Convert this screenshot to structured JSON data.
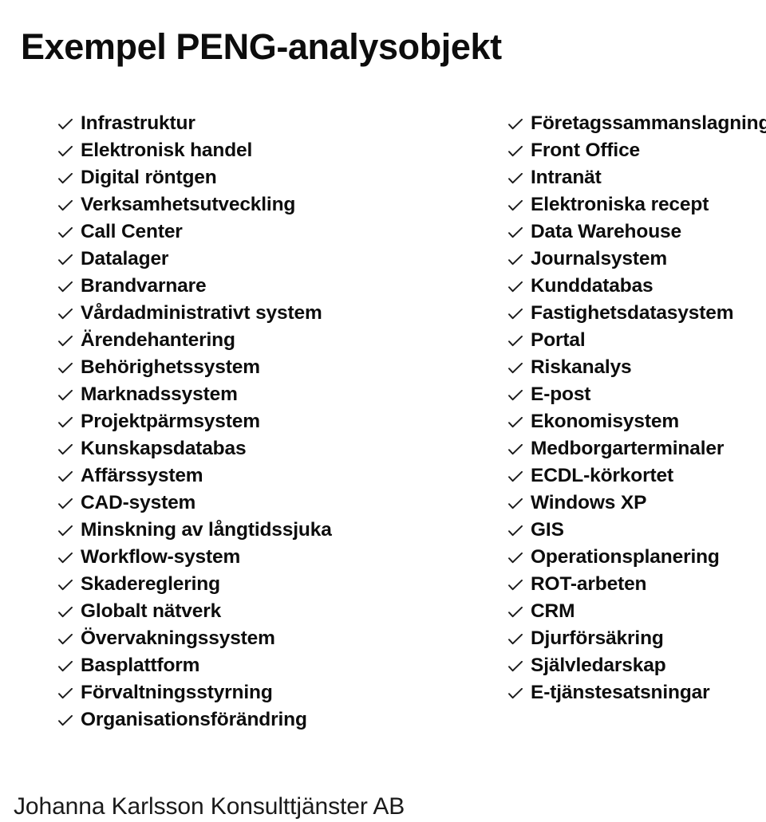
{
  "slide": {
    "title": "Exempel PENG-analysobjekt",
    "footer": "Johanna Karlsson Konsulttjänster AB",
    "bullet_icon": "check-icon",
    "text_color": "#0d0d0d",
    "background_color": "#ffffff"
  },
  "left_column": {
    "items": [
      {
        "label": "Infrastruktur"
      },
      {
        "label": "Elektronisk handel"
      },
      {
        "label": "Digital röntgen"
      },
      {
        "label": "Verksamhetsutveckling"
      },
      {
        "label": "Call Center"
      },
      {
        "label": "Datalager"
      },
      {
        "label": "Brandvarnare"
      },
      {
        "label": "Vårdadministrativt system"
      },
      {
        "label": "Ärendehantering"
      },
      {
        "label": "Behörighetssystem"
      },
      {
        "label": "Marknadssystem"
      },
      {
        "label": "Projektpärmsystem"
      },
      {
        "label": "Kunskapsdatabas"
      },
      {
        "label": "Affärssystem"
      },
      {
        "label": "CAD-system"
      },
      {
        "label": "Minskning av långtidssjuka"
      },
      {
        "label": "Workflow-system"
      },
      {
        "label": "Skadereglering"
      },
      {
        "label": "Globalt nätverk"
      },
      {
        "label": "Övervakningssystem"
      },
      {
        "label": "Basplattform"
      },
      {
        "label": "Förvaltningsstyrning"
      },
      {
        "label": "Organisationsförändring"
      }
    ]
  },
  "right_column": {
    "items": [
      {
        "label": "Företagssammanslagning"
      },
      {
        "label": "Front Office"
      },
      {
        "label": "Intranät"
      },
      {
        "label": "Elektroniska recept"
      },
      {
        "label": "Data Warehouse"
      },
      {
        "label": "Journalsystem"
      },
      {
        "label": "Kunddatabas"
      },
      {
        "label": "Fastighetsdatasystem"
      },
      {
        "label": "Portal"
      },
      {
        "label": "Riskanalys"
      },
      {
        "label": "E-post"
      },
      {
        "label": "Ekonomisystem"
      },
      {
        "label": "Medborgarterminaler"
      },
      {
        "label": "ECDL-körkortet"
      },
      {
        "label": "Windows XP"
      },
      {
        "label": "GIS"
      },
      {
        "label": "Operationsplanering"
      },
      {
        "label": "ROT-arbeten"
      },
      {
        "label": "CRM"
      },
      {
        "label": "Djurförsäkring"
      },
      {
        "label": "Självledarskap"
      },
      {
        "label": "E-tjänstesatsningar"
      }
    ]
  }
}
